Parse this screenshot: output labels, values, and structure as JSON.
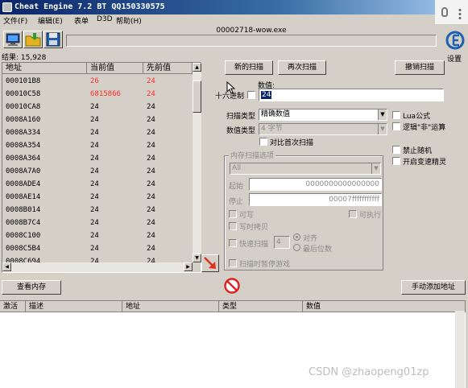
{
  "window": {
    "title": "Cheat Engine 7.2 BT QQ150330575"
  },
  "menu": {
    "file": "文件(F)",
    "edit": "编辑(E)",
    "table": "表单",
    "d3d": "D3D",
    "help": "帮助(H)"
  },
  "process": {
    "name": "00002718-wow.exe"
  },
  "settings_label": "设置",
  "results": {
    "label": "结果: 15,928"
  },
  "columns": {
    "address": "地址",
    "current": "当前值",
    "previous": "先前值"
  },
  "rows": [
    {
      "address": "000101B8",
      "current": "26",
      "previous": "24",
      "changed": true
    },
    {
      "address": "00010C58",
      "current": "6815866",
      "previous": "24",
      "changed": true
    },
    {
      "address": "00010CA8",
      "current": "24",
      "previous": "24",
      "changed": false
    },
    {
      "address": "0008A160",
      "current": "24",
      "previous": "24",
      "changed": false
    },
    {
      "address": "0008A334",
      "current": "24",
      "previous": "24",
      "changed": false
    },
    {
      "address": "0008A354",
      "current": "24",
      "previous": "24",
      "changed": false
    },
    {
      "address": "0008A364",
      "current": "24",
      "previous": "24",
      "changed": false
    },
    {
      "address": "0008A7A0",
      "current": "24",
      "previous": "24",
      "changed": false
    },
    {
      "address": "0008ADE4",
      "current": "24",
      "previous": "24",
      "changed": false
    },
    {
      "address": "0008AE14",
      "current": "24",
      "previous": "24",
      "changed": false
    },
    {
      "address": "0008B014",
      "current": "24",
      "previous": "24",
      "changed": false
    },
    {
      "address": "0008B7C4",
      "current": "24",
      "previous": "24",
      "changed": false
    },
    {
      "address": "0008C100",
      "current": "24",
      "previous": "24",
      "changed": false
    },
    {
      "address": "0008C5B4",
      "current": "24",
      "previous": "24",
      "changed": false
    },
    {
      "address": "0008C694",
      "current": "24",
      "previous": "24",
      "changed": false
    }
  ],
  "scan": {
    "new_scan": "新的扫描",
    "next_scan": "再次扫描",
    "undo_scan": "撤销扫描",
    "value_label": "数值:",
    "hex_label": "十六进制",
    "value": "24",
    "scan_type_label": "扫描类型",
    "scan_type_value": "精确数值",
    "value_type_label": "数值类型",
    "value_type_value": "4 字节",
    "compare_first": "对比首次扫描",
    "lua_formula": "Lua公式",
    "not_logic": "逻辑\"非\"运算",
    "no_random": "禁止随机",
    "speedhack": "开启变速精灵"
  },
  "memory_options": {
    "title": "内存扫描选项",
    "region": "All",
    "start_label": "起始",
    "start_value": "0000000000000000",
    "stop_label": "停止",
    "stop_value": "00007fffffffffff",
    "writable": "可写",
    "executable": "可执行",
    "copy_on_write": "写时拷贝",
    "fast_scan": "快速扫描",
    "fast_scan_value": "4",
    "alignment": "对齐",
    "last_digits": "最后位数",
    "pause_game": "扫描时暂停游戏"
  },
  "buttons": {
    "view_memory": "查看内存",
    "add_address": "手动添加地址"
  },
  "lower_columns": {
    "active": "激活",
    "description": "描述",
    "address": "地址",
    "type": "类型",
    "value": "数值"
  },
  "watermark": "CSDN @zhaopeng01zp",
  "colors": {
    "changed_value": "#ff2a2a",
    "title_start": "#0a246a",
    "title_end": "#a6caf0"
  }
}
